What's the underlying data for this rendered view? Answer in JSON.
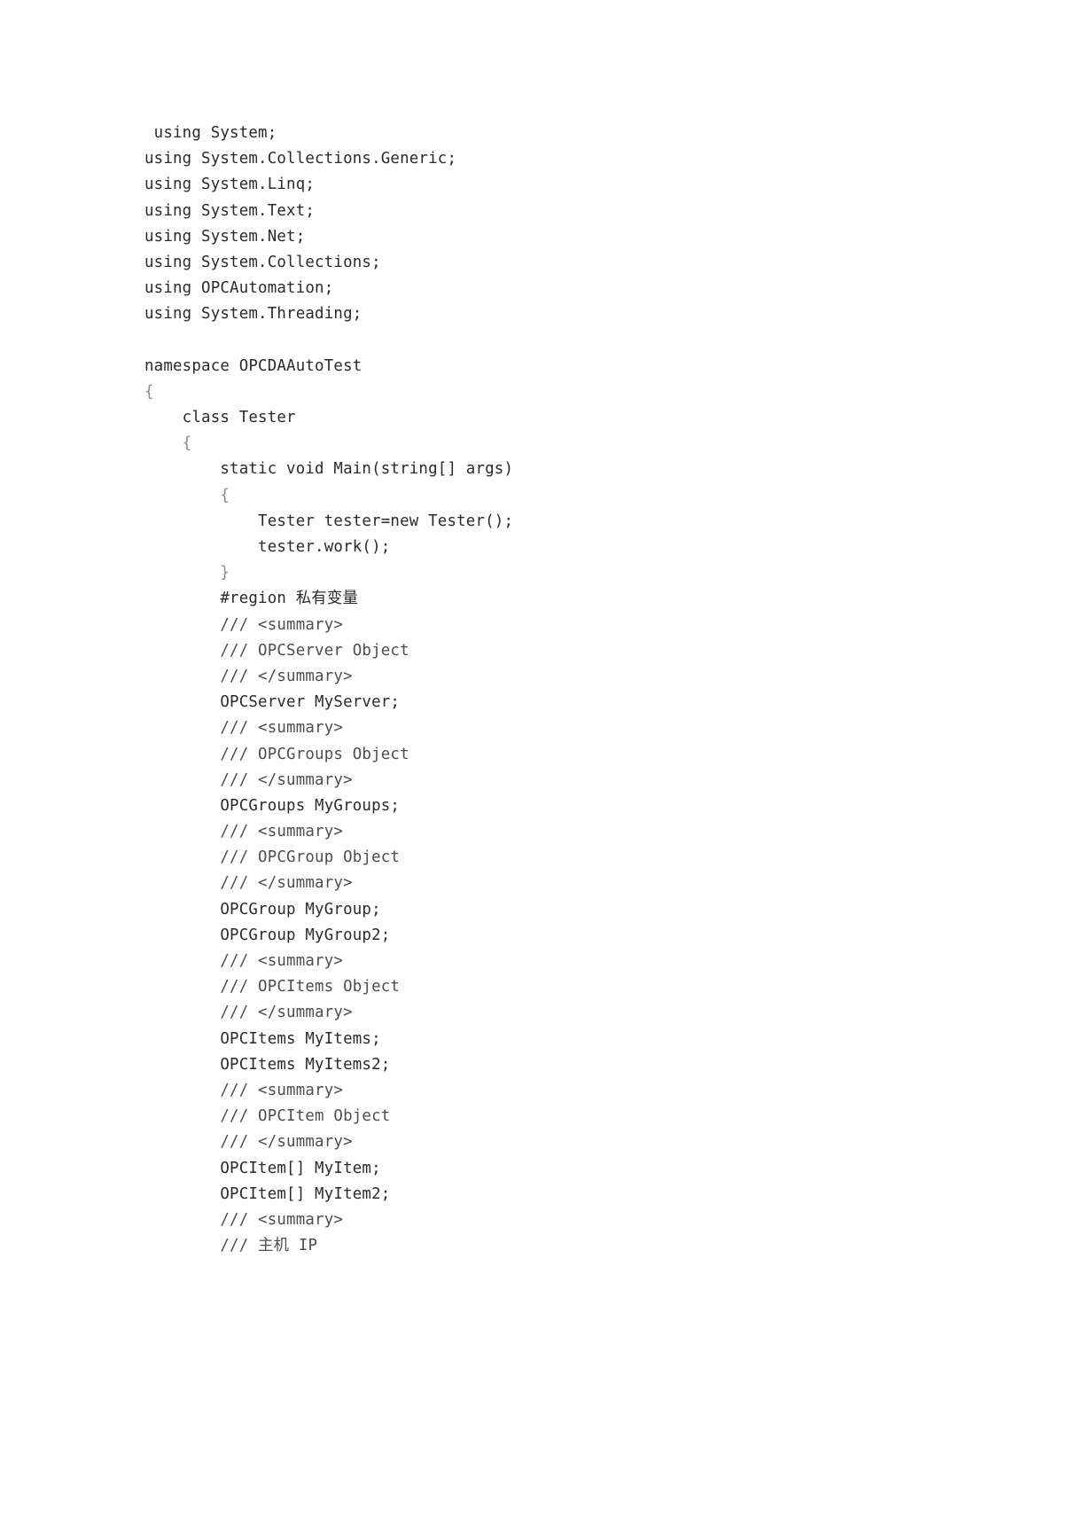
{
  "document": {
    "page_background": "#ffffff",
    "text_color": "#2a2a2a",
    "brace_color": "#8a8a8a",
    "comment_color": "#4d4d4d",
    "language": "csharp",
    "namespace": "OPCDAAutoTest",
    "class": "Tester"
  },
  "code": {
    "lines": [
      {
        "text": " using System;",
        "kind": "code"
      },
      {
        "text": "using System.Collections.Generic;",
        "kind": "code"
      },
      {
        "text": "using System.Linq;",
        "kind": "code"
      },
      {
        "text": "using System.Text;",
        "kind": "code"
      },
      {
        "text": "using System.Net;",
        "kind": "code"
      },
      {
        "text": "using System.Collections;",
        "kind": "code"
      },
      {
        "text": "using OPCAutomation;",
        "kind": "code"
      },
      {
        "text": "using System.Threading;",
        "kind": "code"
      },
      {
        "text": "",
        "kind": "blank"
      },
      {
        "text": "namespace OPCDAAutoTest",
        "kind": "code"
      },
      {
        "text": "{",
        "kind": "brace"
      },
      {
        "text": "    class Tester",
        "kind": "code"
      },
      {
        "text": "    {",
        "kind": "brace"
      },
      {
        "text": "        static void Main(string[] args)",
        "kind": "code"
      },
      {
        "text": "        {",
        "kind": "brace"
      },
      {
        "text": "            Tester tester=new Tester();",
        "kind": "code"
      },
      {
        "text": "            tester.work();",
        "kind": "code"
      },
      {
        "text": "        }",
        "kind": "brace"
      },
      {
        "text": "        #region 私有变量",
        "kind": "code"
      },
      {
        "text": "        /// <summary>",
        "kind": "comment"
      },
      {
        "text": "        /// OPCServer Object",
        "kind": "comment"
      },
      {
        "text": "        /// </summary>",
        "kind": "comment"
      },
      {
        "text": "        OPCServer MyServer;",
        "kind": "code"
      },
      {
        "text": "        /// <summary>",
        "kind": "comment"
      },
      {
        "text": "        /// OPCGroups Object",
        "kind": "comment"
      },
      {
        "text": "        /// </summary>",
        "kind": "comment"
      },
      {
        "text": "        OPCGroups MyGroups;",
        "kind": "code"
      },
      {
        "text": "        /// <summary>",
        "kind": "comment"
      },
      {
        "text": "        /// OPCGroup Object",
        "kind": "comment"
      },
      {
        "text": "        /// </summary>",
        "kind": "comment"
      },
      {
        "text": "        OPCGroup MyGroup;",
        "kind": "code"
      },
      {
        "text": "        OPCGroup MyGroup2;",
        "kind": "code"
      },
      {
        "text": "        /// <summary>",
        "kind": "comment"
      },
      {
        "text": "        /// OPCItems Object",
        "kind": "comment"
      },
      {
        "text": "        /// </summary>",
        "kind": "comment"
      },
      {
        "text": "        OPCItems MyItems;",
        "kind": "code"
      },
      {
        "text": "        OPCItems MyItems2;",
        "kind": "code"
      },
      {
        "text": "        /// <summary>",
        "kind": "comment"
      },
      {
        "text": "        /// OPCItem Object",
        "kind": "comment"
      },
      {
        "text": "        /// </summary>",
        "kind": "comment"
      },
      {
        "text": "        OPCItem[] MyItem;",
        "kind": "code"
      },
      {
        "text": "        OPCItem[] MyItem2;",
        "kind": "code"
      },
      {
        "text": "        /// <summary>",
        "kind": "comment"
      },
      {
        "text": "        /// 主机 IP",
        "kind": "comment"
      }
    ]
  }
}
